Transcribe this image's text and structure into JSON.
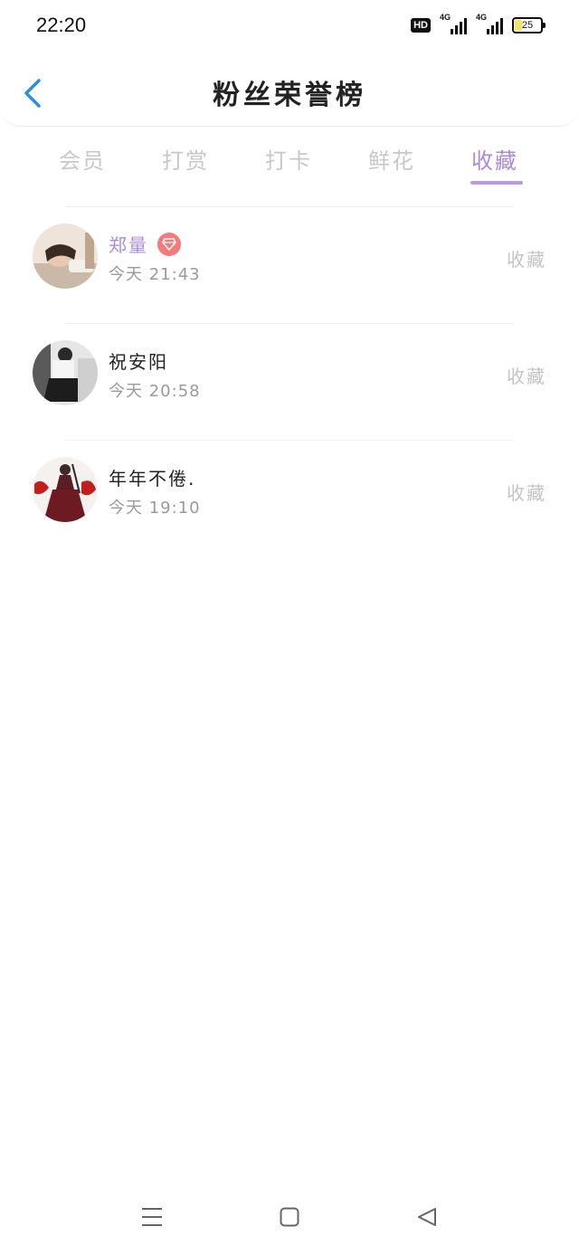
{
  "status_bar": {
    "time": "22:20",
    "hd_label": "HD",
    "network_1": "4G",
    "network_2": "4G",
    "battery": "25"
  },
  "header": {
    "title": "粉丝荣誉榜"
  },
  "tabs": [
    {
      "label": "会员",
      "active": false
    },
    {
      "label": "打赏",
      "active": false
    },
    {
      "label": "打卡",
      "active": false
    },
    {
      "label": "鲜花",
      "active": false
    },
    {
      "label": "收藏",
      "active": true
    }
  ],
  "fans": [
    {
      "name": "郑量",
      "vip": true,
      "time": "今天 21:43",
      "action": "收藏"
    },
    {
      "name": "祝安阳",
      "vip": false,
      "time": "今天 20:58",
      "action": "收藏"
    },
    {
      "name": "年年不倦.",
      "vip": false,
      "time": "今天 19:10",
      "action": "收藏"
    }
  ],
  "colors": {
    "accent": "#a98bd8",
    "back_icon": "#2b8fe0",
    "vip_badge": "#f47b7b"
  },
  "icons": {
    "back": "chevron-left-icon",
    "vip": "diamond-icon",
    "nav_menu": "menu-icon",
    "nav_home": "square-icon",
    "nav_back": "triangle-back-icon"
  }
}
